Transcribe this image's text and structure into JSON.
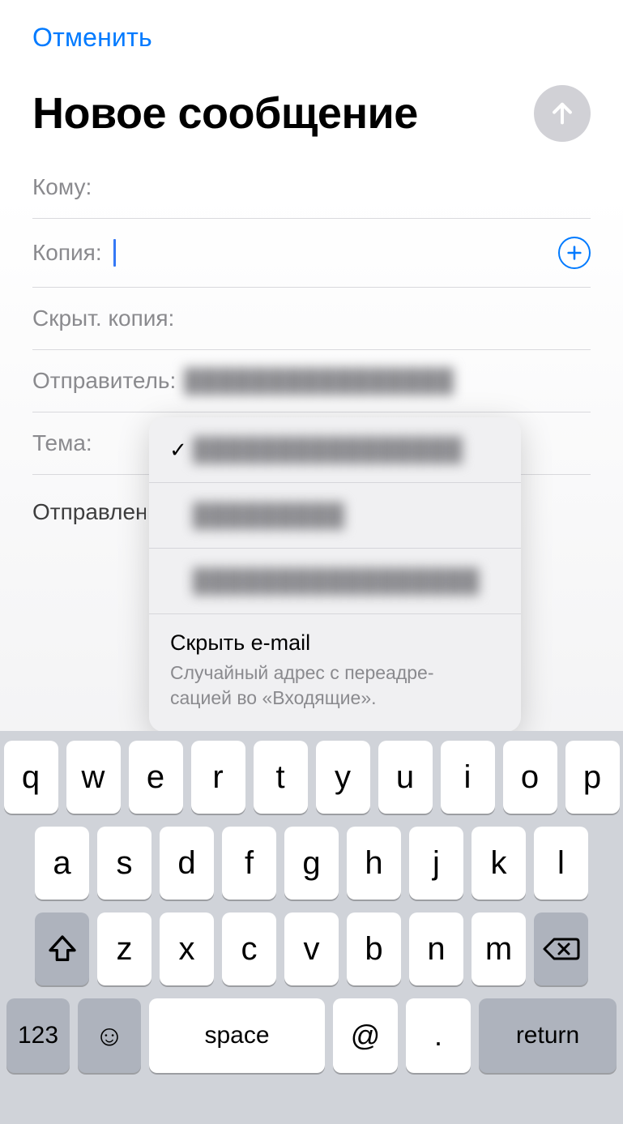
{
  "header": {
    "cancel": "Отменить",
    "title": "Новое сообщение"
  },
  "fields": {
    "to_label": "Кому:",
    "cc_label": "Копия:",
    "bcc_label": "Скрыт. копия:",
    "from_label": "Отправитель:",
    "from_value_obscured": "████████████████",
    "subject_label": "Тема:"
  },
  "body": {
    "text": "Отправлен"
  },
  "popover": {
    "options": [
      {
        "selected": true,
        "label_obscured": "████████████████"
      },
      {
        "selected": false,
        "label_obscured": "█████████"
      },
      {
        "selected": false,
        "label_obscured": "█████████████████"
      }
    ],
    "hide_email": {
      "title": "Скрыть e-mail",
      "subtitle": "Случайный адрес с переадре-\nсацией во «Входящие»."
    }
  },
  "keyboard": {
    "row1": [
      "q",
      "w",
      "e",
      "r",
      "t",
      "y",
      "u",
      "i",
      "o",
      "p"
    ],
    "row2": [
      "a",
      "s",
      "d",
      "f",
      "g",
      "h",
      "j",
      "k",
      "l"
    ],
    "row3": [
      "z",
      "x",
      "c",
      "v",
      "b",
      "n",
      "m"
    ],
    "num": "123",
    "space": "space",
    "at": "@",
    "dot": ".",
    "return": "return"
  }
}
